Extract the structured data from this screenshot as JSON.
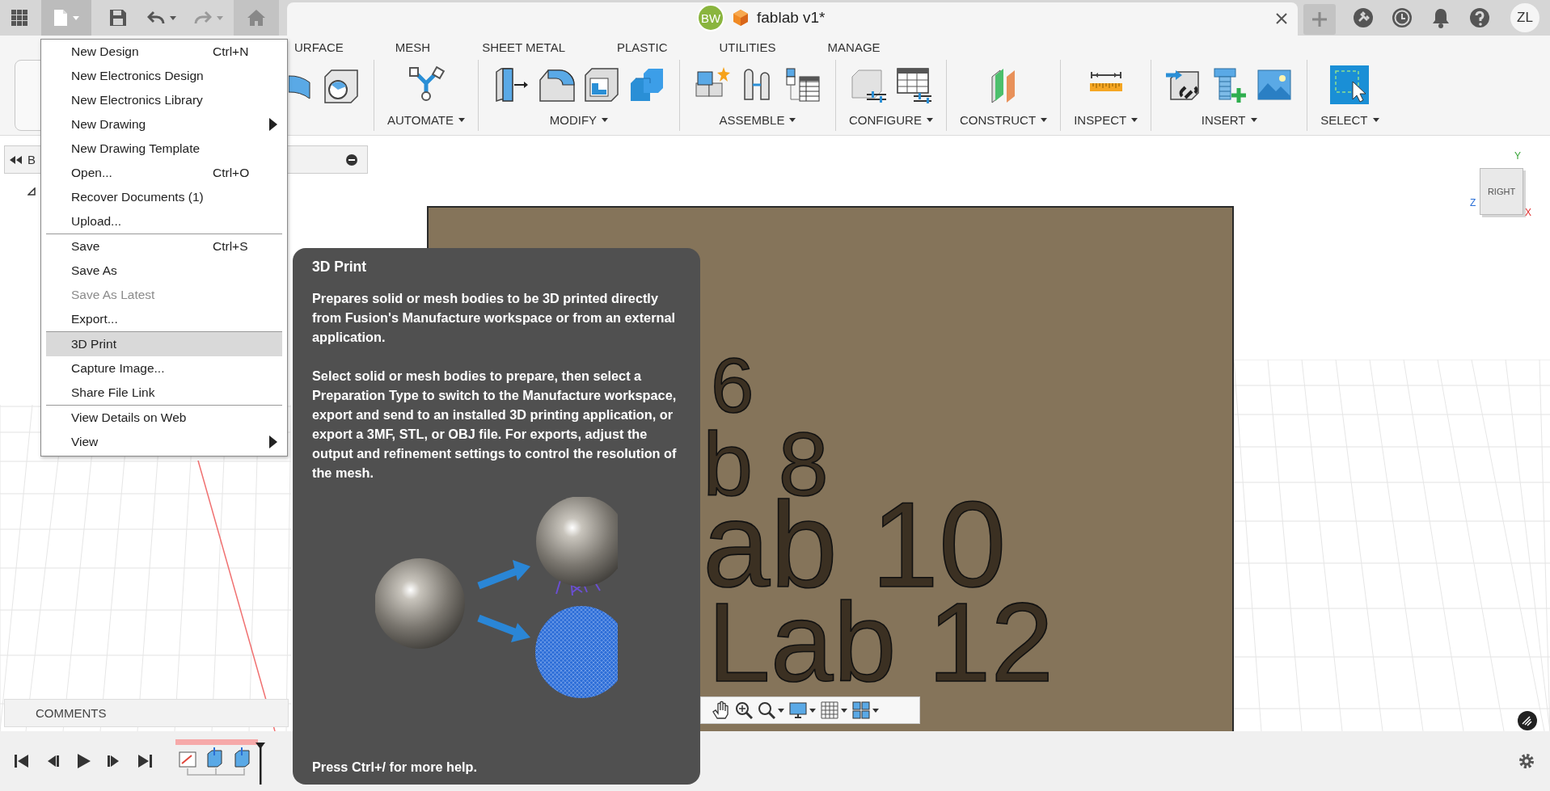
{
  "app_bar": {
    "collaborator_avatar": "BW",
    "document_tab": {
      "title": "fablab v1*"
    },
    "user_avatar": "ZL"
  },
  "toolbar": {
    "tabs": [
      {
        "label": "URFACE",
        "selected": false
      },
      {
        "label": "MESH",
        "selected": false
      },
      {
        "label": "SHEET METAL",
        "selected": false
      },
      {
        "label": "PLASTIC",
        "selected": false
      },
      {
        "label": "UTILITIES",
        "selected": false
      },
      {
        "label": "MANAGE",
        "selected": false
      }
    ],
    "groups": [
      {
        "label": "AUTOMATE"
      },
      {
        "label": "MODIFY"
      },
      {
        "label": "ASSEMBLE"
      },
      {
        "label": "CONFIGURE"
      },
      {
        "label": "CONSTRUCT"
      },
      {
        "label": "INSPECT"
      },
      {
        "label": "INSERT"
      },
      {
        "label": "SELECT"
      }
    ]
  },
  "browser": {
    "title": "B"
  },
  "viewport": {
    "model_texts": [
      "6",
      "b 8",
      "ab 10",
      "Lab 12"
    ],
    "view_cube": {
      "face": "RIGHT",
      "axes": [
        "Y",
        "Z",
        "X"
      ]
    }
  },
  "comments": {
    "label": "COMMENTS"
  },
  "file_menu": {
    "sections": [
      [
        {
          "label": "New Design",
          "shortcut": "Ctrl+N",
          "submenu": false,
          "disabled": false,
          "selected": false
        },
        {
          "label": "New Electronics Design",
          "submenu": false,
          "disabled": false,
          "selected": false
        },
        {
          "label": "New Electronics Library",
          "submenu": false,
          "disabled": false,
          "selected": false
        },
        {
          "label": "New Drawing",
          "submenu": true,
          "disabled": false,
          "selected": false
        },
        {
          "label": "New Drawing Template",
          "submenu": false,
          "disabled": false,
          "selected": false
        },
        {
          "label": "Open...",
          "shortcut": "Ctrl+O",
          "submenu": false,
          "disabled": false,
          "selected": false
        },
        {
          "label": "Recover Documents (1)",
          "submenu": false,
          "disabled": false,
          "selected": false
        },
        {
          "label": "Upload...",
          "submenu": false,
          "disabled": false,
          "selected": false
        }
      ],
      [
        {
          "label": "Save",
          "shortcut": "Ctrl+S",
          "submenu": false,
          "disabled": false,
          "selected": false
        },
        {
          "label": "Save As",
          "submenu": false,
          "disabled": false,
          "selected": false
        },
        {
          "label": "Save As Latest",
          "submenu": false,
          "disabled": true,
          "selected": false
        },
        {
          "label": "Export...",
          "submenu": false,
          "disabled": false,
          "selected": false
        }
      ],
      [
        {
          "label": "3D Print",
          "submenu": false,
          "disabled": false,
          "selected": true
        },
        {
          "label": "Capture Image...",
          "submenu": false,
          "disabled": false,
          "selected": false
        },
        {
          "label": "Share File Link",
          "submenu": false,
          "disabled": false,
          "selected": false
        }
      ],
      [
        {
          "label": "View Details on Web",
          "submenu": false,
          "disabled": false,
          "selected": false
        },
        {
          "label": "View",
          "submenu": true,
          "disabled": false,
          "selected": false
        }
      ]
    ]
  },
  "tooltip": {
    "title": "3D Print",
    "paragraphs": [
      "Prepares solid or mesh bodies to be 3D printed directly from Fusion's Manufacture workspace or from an external application.",
      "Select solid or mesh bodies to prepare, then select a Preparation Type to switch to the Manufacture workspace, export and send to an installed 3D printing application, or export a 3MF, STL, or OBJ file. For exports, adjust the output and refinement settings to control the resolution of the mesh."
    ],
    "footer": "Press Ctrl+/ for more help."
  }
}
